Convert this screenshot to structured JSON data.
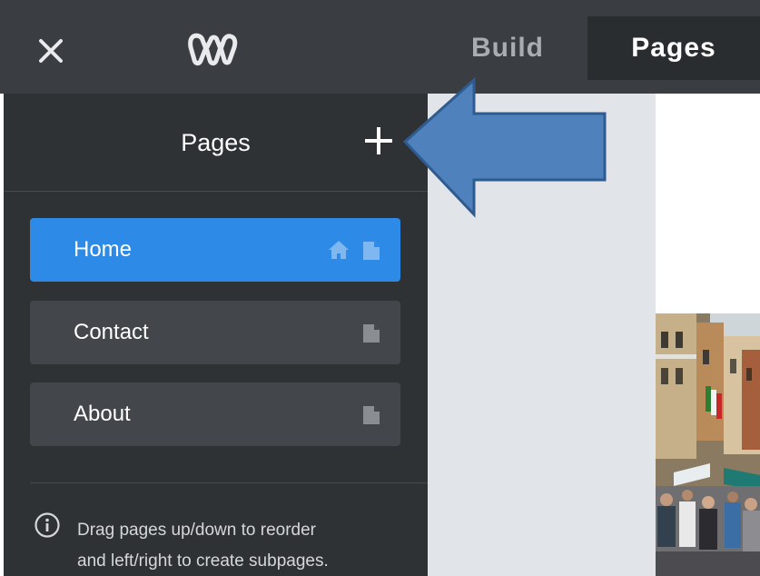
{
  "topbar": {
    "close_icon": "close-icon",
    "logo_icon": "weebly-logo-icon",
    "tabs": [
      {
        "label": "Build",
        "active": false
      },
      {
        "label": "Pages",
        "active": true
      }
    ]
  },
  "sidebar": {
    "title": "Pages",
    "add_icon": "plus-icon",
    "pages": [
      {
        "label": "Home",
        "active": true,
        "icons": [
          "home-icon",
          "page-icon"
        ]
      },
      {
        "label": "Contact",
        "active": false,
        "icons": [
          "page-icon"
        ]
      },
      {
        "label": "About",
        "active": false,
        "icons": [
          "page-icon"
        ]
      }
    ],
    "help_line1": "Drag pages up/down to reorder",
    "help_line2": "and left/right to create subpages.",
    "info_icon": "info-icon"
  },
  "colors": {
    "topbar": "#3a3d41",
    "sidebar": "#2f3235",
    "page_item": "#43464a",
    "active_blue": "#2d8ae6",
    "callout_arrow": "#4f81bd",
    "preview_gray": "#e1e5ea"
  }
}
